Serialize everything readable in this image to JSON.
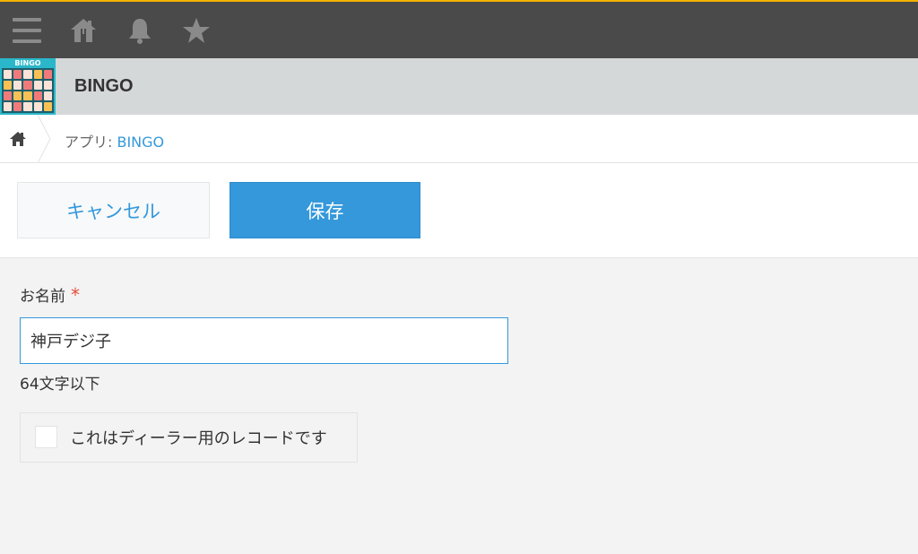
{
  "topbar": {
    "icons": [
      "menu-icon",
      "home-icon",
      "bell-icon",
      "star-icon"
    ],
    "accent_color": "#f5b200",
    "background": "#4a4a4a"
  },
  "app": {
    "logo_text": "BINGO",
    "title": "BINGO"
  },
  "breadcrumb": {
    "prefix": "アプリ: ",
    "link": "BINGO"
  },
  "actions": {
    "cancel_label": "キャンセル",
    "save_label": "保存",
    "primary_color": "#3498db"
  },
  "form": {
    "name_label": "お名前",
    "required_mark": "*",
    "name_value": "神戸デジ子",
    "name_hint": "64文字以下",
    "dealer_checkbox_label": "これはディーラー用のレコードです",
    "dealer_checked": false
  }
}
